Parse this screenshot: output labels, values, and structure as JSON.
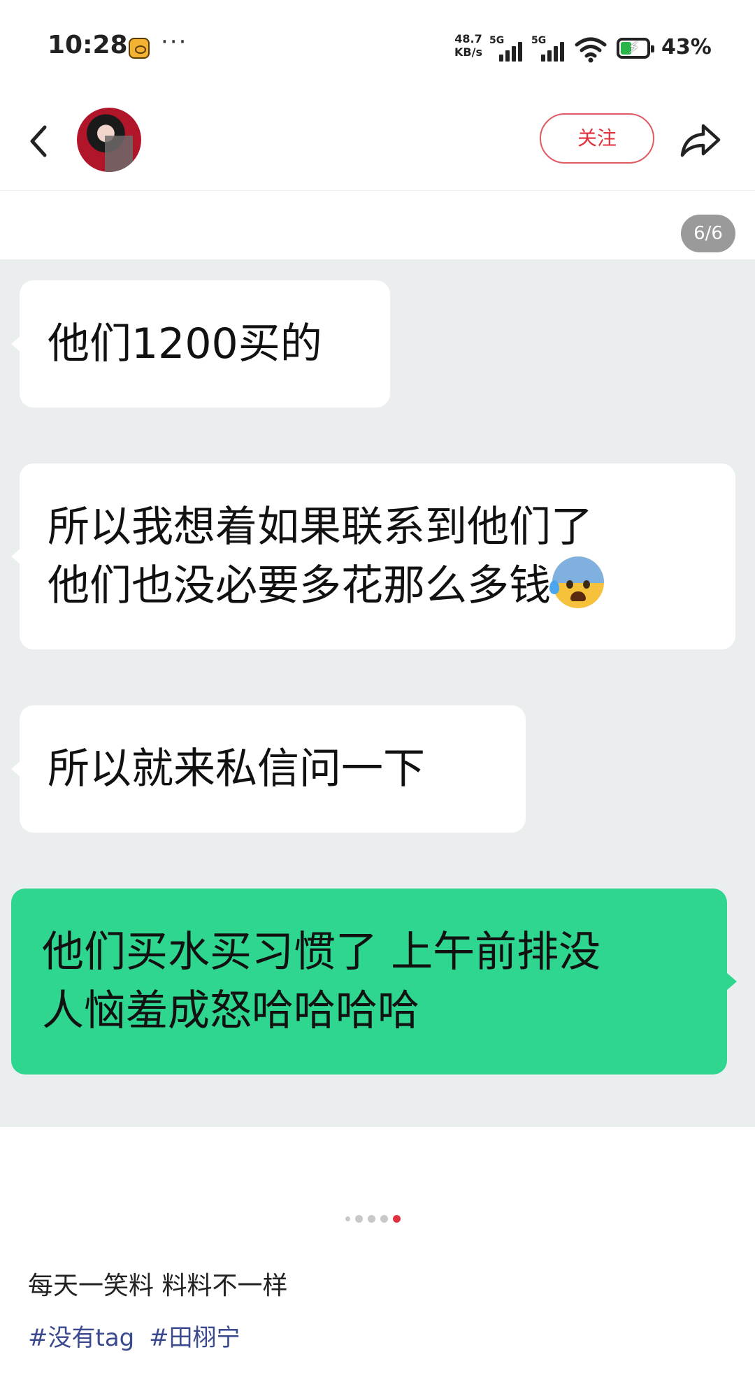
{
  "status_bar": {
    "time": "10:28",
    "more": "···",
    "net_speed_value": "48.7",
    "net_speed_unit": "KB/s",
    "signal_1_label": "5G",
    "signal_2_label": "5G",
    "battery": "43%",
    "battery_level": 0.43,
    "battery_charging": true,
    "notification_icon": "app-notification-icon"
  },
  "header": {
    "back_icon": "chevron-left-icon",
    "follow_label": "关注",
    "share_icon": "share-arrow-icon"
  },
  "image": {
    "page_counter": "6/6",
    "bubbles": [
      {
        "side": "left",
        "lines": [
          "他们1200买的"
        ]
      },
      {
        "side": "left",
        "lines": [
          "所以我想着如果联系到他们了",
          "他们也没必要多花那么多钱"
        ],
        "trailing_emoji": "anxious-face-with-sweat-emoji"
      },
      {
        "side": "left",
        "lines": [
          "所以就来私信问一下"
        ]
      },
      {
        "side": "right",
        "lines": [
          "他们买水买习惯了 上午前排没",
          "人恼羞成怒哈哈哈哈"
        ]
      }
    ],
    "colors": {
      "chat_bg": "#eaeeee",
      "incoming_bubble": "#ffffff",
      "outgoing_bubble": "#2fd68f"
    }
  },
  "carousel": {
    "total": 5,
    "active_index": 4
  },
  "post": {
    "caption": "每天一笑料 料料不一样",
    "tags": [
      "#没有tag",
      "#田栩宁"
    ]
  },
  "accent_color": "#e02f3d"
}
